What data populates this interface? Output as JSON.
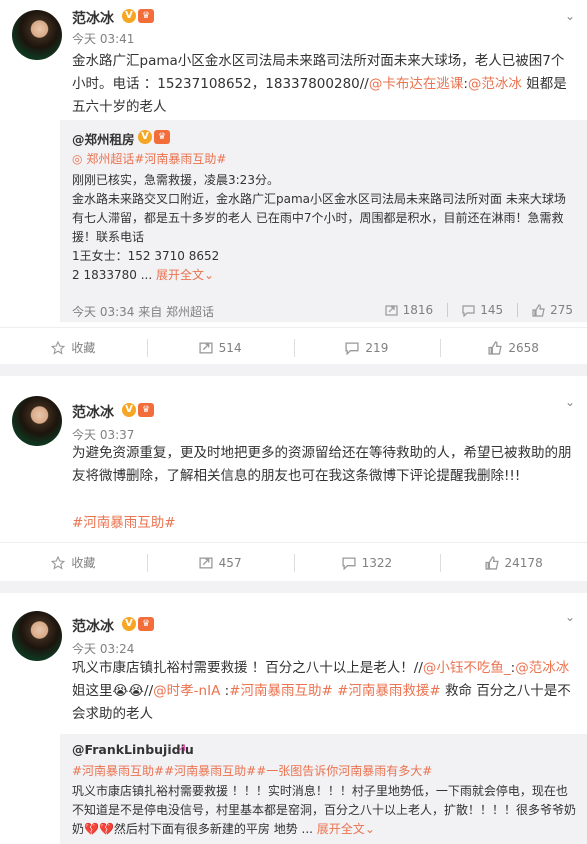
{
  "posts": [
    {
      "user": "范冰冰",
      "time": "今天 03:41",
      "text_parts": [
        "金水路广汇pama小区金水区司法局未来路司法所对面未来大球场，老人已被困7个小时。电话 ：15237108652，18337800280//",
        "@卡布达在逃课",
        ":",
        "@范冰冰",
        " 姐都是五六十岁的老人"
      ],
      "quote": {
        "user": "@郑州租房",
        "tags": "郑州超话#河南暴雨互助#",
        "lines": [
          "刚刚已核实，急需救援，凌晨3:23分。",
          "金水路未来路交叉口附近，金水路广汇pama小区金水区司法局未来路司法所对面 未来大球场  有七人滞留，都是五十多岁的老人 已在雨中7个小时，周围都是积水，目前还在淋雨！急需救援！联系电话",
          "1王女士：152 3710 8652",
          "2 1833780 ..."
        ],
        "expand": "展开全文",
        "foot": "今天 03:34 来自 郑州超话",
        "reposts": "1816",
        "comments": "145",
        "likes": "275"
      },
      "actions": {
        "fav": "收藏",
        "repost": "514",
        "comment": "219",
        "like": "2658"
      }
    },
    {
      "user": "范冰冰",
      "time": "今天 03:37",
      "text": "为避免资源重复，更及时地把更多的资源留给还在等待救助的人，希望已被救助的朋友将微博删除，了解相关信息的朋友也可在我这条微博下评论提醒我删除!!!",
      "tag": "#河南暴雨互助#",
      "actions": {
        "fav": "收藏",
        "repost": "457",
        "comment": "1322",
        "like": "24178"
      }
    },
    {
      "user": "范冰冰",
      "time": "今天 03:24",
      "text_parts": [
        "巩义市康店镇扎裕村需要救援 ！百分之八十以上是老人！//",
        "@小钰不吃鱼_",
        ":",
        "@范冰冰",
        " 姐这里😭😭//",
        "@时孝-nIA",
        " :",
        "#河南暴雨互助#",
        " ",
        "#河南暴雨救援#",
        " 救命 百分之八十是不会求助的老人"
      ],
      "quote": {
        "user": "@FrankLinbujidiu",
        "tags": "#河南暴雨互助##河南暴雨互助##一张图告诉你河南暴雨有多大#",
        "lines": [
          "巩义市康店镇扎裕村需要救援 ！！！实时消息！！！村子里地势低，一下雨就会停电，现在也不知道是不是停电没信号，村里基本都是窑洞，百分之八十以上老人，扩散！！！！很多爷爷奶奶💔💔然后村下面有很多新建的平房 地势 ..."
        ],
        "expand": "展开全文"
      }
    }
  ],
  "colors": {
    "accent": "#eb7350",
    "badge": "#f5a623",
    "bg": "#f2f2f5"
  }
}
